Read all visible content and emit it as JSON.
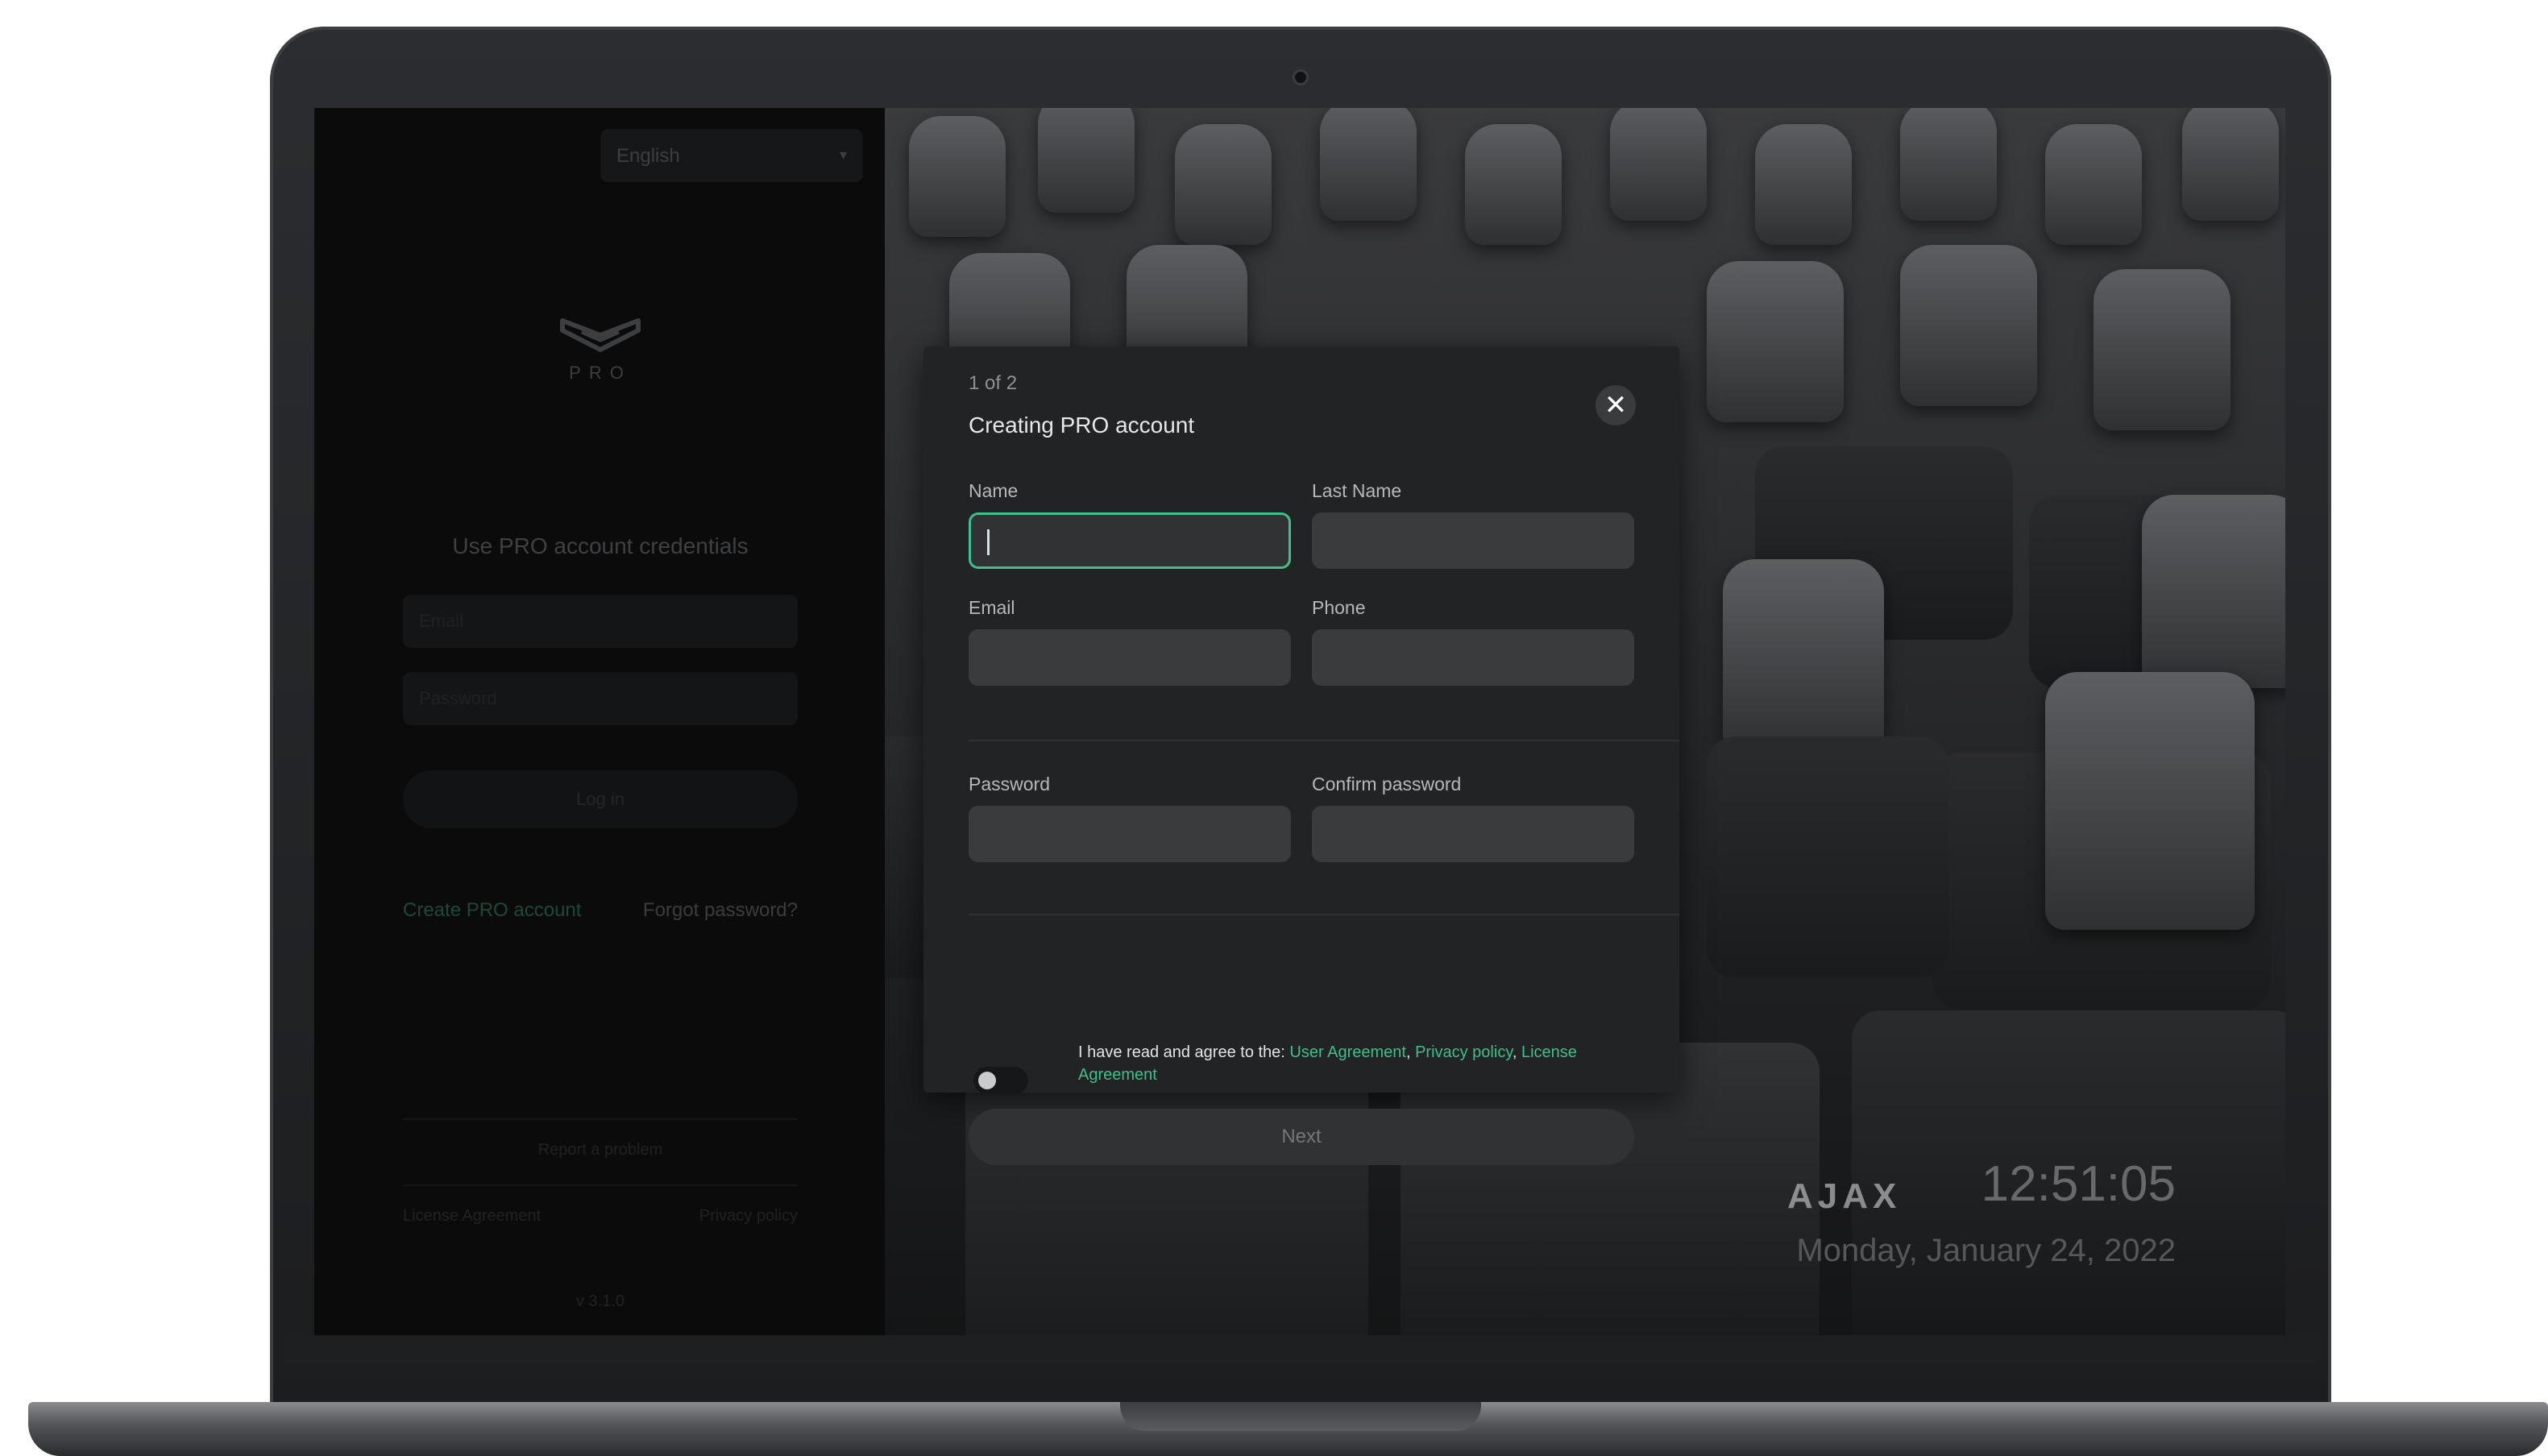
{
  "left_panel": {
    "language": "English",
    "logo_text": "PRO",
    "title": "Use PRO account credentials",
    "email_placeholder": "Email",
    "password_placeholder": "Password",
    "login_label": "Log in",
    "create_account": "Create PRO account",
    "forgot_password": "Forgot password?",
    "report_problem": "Report a problem",
    "license_agreement": "License Agreement",
    "privacy_policy": "Privacy policy",
    "version": "v 3.1.0"
  },
  "background": {
    "brand": "AJAX",
    "time": "12:51:05",
    "date": "Monday, January 24, 2022"
  },
  "modal": {
    "step": "1 of 2",
    "title": "Creating PRO account",
    "name_label": "Name",
    "last_name_label": "Last Name",
    "email_label": "Email",
    "phone_label": "Phone",
    "password_label": "Password",
    "confirm_password_label": "Confirm password",
    "agree_text": "I have read and agree to the: ",
    "user_agreement": "User Agreement",
    "sep1": ", ",
    "privacy_policy": "Privacy policy",
    "sep2": ", ",
    "license_agreement": "License Agreement",
    "terms_accepted": false,
    "next_label": "Next"
  },
  "colors": {
    "accent": "#3fbf8a",
    "modal_bg": "#222324",
    "field_bg": "#3a3b3d"
  }
}
